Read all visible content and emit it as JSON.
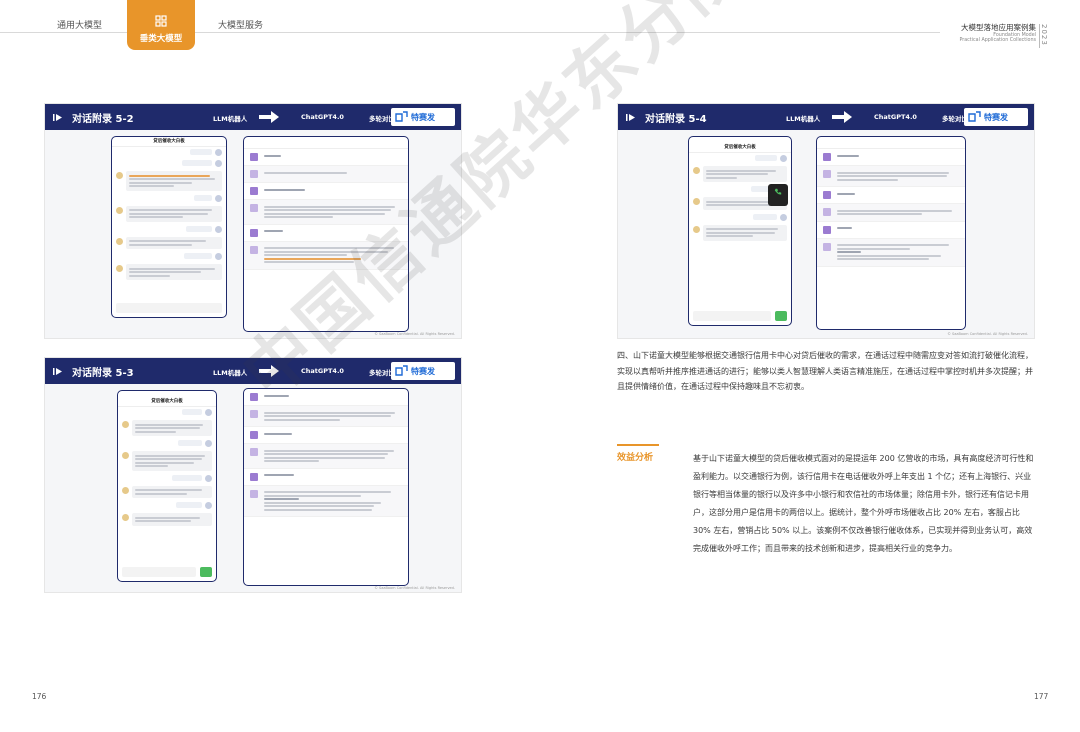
{
  "header": {
    "tabs": [
      "通用大模型",
      "垂类大模型",
      "大模型服务"
    ],
    "active_tab": "垂类大模型",
    "brand_title": "大模型落地应用案例集",
    "brand_sub1": "Foundation Model",
    "brand_sub2": "Practical Application Collections",
    "year": "2023"
  },
  "slides": [
    {
      "title": "对话附录 5-2",
      "llm": "LLM机器人",
      "gpt": "ChatGPT4.0",
      "multi": "多轮对比",
      "logo": "特赛发",
      "phone_title": "贷后催收大白板"
    },
    {
      "title": "对话附录 5-3",
      "llm": "LLM机器人",
      "gpt": "ChatGPT4.0",
      "multi": "多轮对比",
      "logo": "特赛发",
      "phone_title": "贷后催收大白板"
    },
    {
      "title": "对话附录 5-4",
      "llm": "LLM机器人",
      "gpt": "ChatGPT4.0",
      "multi": "多轮对比",
      "logo": "特赛发",
      "phone_title": "贷后催收大白板"
    }
  ],
  "slide_footer": "© SaaBoom Confidential. All Rights Reserved.",
  "paragraph": "四、山下诺童大模型能够根据交通银行信用卡中心对贷后催收的需求，在通话过程中随需应变对答如流打破催化流程，实现以真帮听并推序推进通话的进行；能够以类人智慧理解人类语言精准施压，在通话过程中掌控时机并多次提醒；并且提供情绪价值，在通话过程中保持趣味且不忘初衷。",
  "section_label": "效益分析",
  "analysis": "基于山下诺童大模型的贷后催收模式面对的是提运年 200 亿营收的市场，具有高度经济可行性和盈利能力。以交通银行为例，该行信用卡在电话催收外呼上年支出 1 个亿；还有上海银行、兴业银行等相当体量的银行以及许多中小银行和农信社的市场体量；除信用卡外，银行还有信记卡用户，这部分用户是信用卡的两倍以上。据统计，整个外呼市场催收占比 20% 左右，客服占比 30% 左右，营销占比 50% 以上。该案例不仅改善银行催收体系，已实现并得到业务认可，高效完成催收外呼工作；而且带来的技术创新和进步，提高相关行业的竞争力。",
  "pages": {
    "left": "176",
    "right": "177"
  },
  "watermark": "中国信通院华东分院",
  "colors": {
    "accent": "#e8952a",
    "navy": "#1f2a6b"
  }
}
